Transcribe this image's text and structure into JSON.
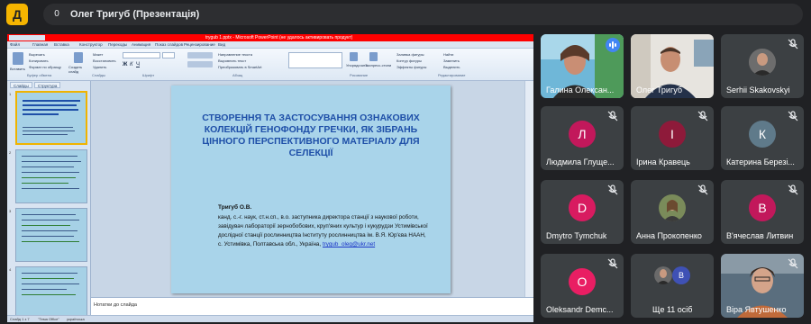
{
  "app": {
    "icon_letter": "Д"
  },
  "header": {
    "participant_count": "0",
    "title": "Олег Тригуб (Презентація)"
  },
  "powerpoint": {
    "window_title": "trygub 1.pptx - Microsoft PowerPoint (не удалось активировать продукт)",
    "menu": [
      "Файл",
      "Главная",
      "Вставка",
      "Конструктор",
      "Переходы",
      "Анимация",
      "Показ слайдов",
      "Рецензирование",
      "Вид"
    ],
    "ribbon": {
      "paste": "Вставить",
      "cut": "Вырезать",
      "copy": "Копировать",
      "format": "Формат по образцу",
      "new_slide": "Создать слайд",
      "layout": "Макет",
      "reset": "Восстановить",
      "delete": "Удалить",
      "group_clipboard": "Буфер обмена",
      "group_slides": "Слайды",
      "group_font": "Шрифт",
      "group_paragraph": "Абзац",
      "group_drawing": "Рисование",
      "group_editing": "Редактирование",
      "text_direction": "Направление текста",
      "align_text": "Выровнять текст",
      "convert_smartart": "Преобразовать в SmartArt",
      "arrange": "Упорядочить",
      "quick_styles": "Экспресс-стили",
      "shape_fill": "Заливка фигуры",
      "shape_outline": "Контур фигуры",
      "shape_effects": "Эффекты фигуры",
      "find": "Найти",
      "replace": "Заменить",
      "select": "Выделить"
    },
    "panel_tabs": [
      "Слайды",
      "Структура"
    ],
    "thumb_numbers": [
      "1",
      "2",
      "3",
      "4"
    ],
    "slide": {
      "title": "СТВОРЕННЯ ТА ЗАСТОСУВАННЯ ОЗНАКОВИХ КОЛЕКЦІЙ ГЕНОФОНДУ ГРЕЧКИ, ЯК ЗІБРАНЬ ЦІННОГО ПЕРСПЕКТИВНОГО МАТЕРІАЛУ ДЛЯ СЕЛЕКЦІЇ",
      "author": "Тригуб О.В.",
      "body": "канд. с.-г. наук, ст.н.сп., в.о. заступника директора станції з наукової роботи, завідувач лабораторії зернобобових, круп'яних культур і кукурудзи Устимівської дослідної станції рослинництва Інституту рослинництва ім. В.Я. Юр'єва НААН,",
      "address": "с. Устимівка, Полтавська обл., Україна,",
      "email": "trygub_oleg@ukr.net"
    },
    "notes_placeholder": "Нотатки до слайда",
    "status": {
      "slide": "Слайд 1 з 7",
      "theme": "\"Тема Office\"",
      "lang": "українська"
    }
  },
  "participants": [
    {
      "name": "Галина Олексан...",
      "type": "photo",
      "speaking": true
    },
    {
      "name": "Олег Тригуб",
      "type": "photo",
      "muted": false
    },
    {
      "name": "Serhii Skakovskyi",
      "type": "photo-avatar",
      "muted": true
    },
    {
      "name": "Людмила Глуще...",
      "initial": "Л",
      "color": "#c2185b",
      "muted": true
    },
    {
      "name": "Ірина Кравець",
      "initial": "І",
      "color": "#8e1a3a",
      "muted": true
    },
    {
      "name": "Катерина Березі...",
      "initial": "К",
      "color": "#5f7a8a",
      "muted": true
    },
    {
      "name": "Dmytro Tymchuk",
      "initial": "D",
      "color": "#d81b60",
      "muted": true
    },
    {
      "name": "Анна Прокопенко",
      "type": "photo-avatar",
      "muted": true
    },
    {
      "name": "В'ячеслав Литвин",
      "initial": "В",
      "color": "#c2185b",
      "muted": true
    },
    {
      "name": "Oleksandr Demc...",
      "initial": "O",
      "color": "#e91e63",
      "muted": true
    },
    {
      "name": "Ще 11 осіб",
      "initial": "В",
      "color": "#3f51b5"
    },
    {
      "name": "Віра Явтушенко",
      "type": "photo",
      "muted": true
    }
  ],
  "colors": {
    "background": "#202124",
    "tile": "#3c4043",
    "accent": "#f5b400",
    "speaking": "#4285f4"
  }
}
